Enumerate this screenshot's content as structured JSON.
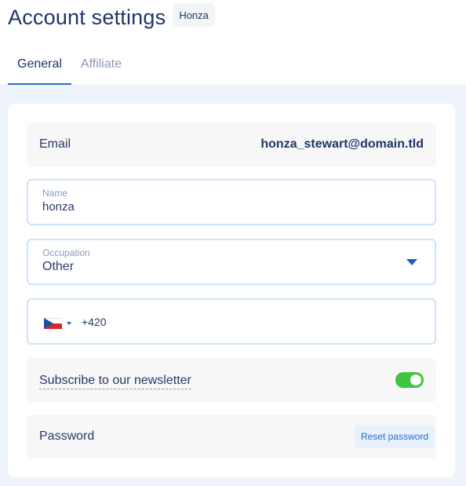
{
  "header": {
    "title": "Account settings",
    "user_badge": "Honza"
  },
  "tabs": [
    {
      "label": "General",
      "active": true
    },
    {
      "label": "Affiliate",
      "active": false
    }
  ],
  "email": {
    "label": "Email",
    "value": "honza_stewart@domain.tld"
  },
  "name_field": {
    "label": "Name",
    "value": "honza"
  },
  "occupation_field": {
    "label": "Occupation",
    "value": "Other"
  },
  "phone_field": {
    "country_flag": "czech-flag-icon",
    "value": "+420"
  },
  "newsletter": {
    "label": "Subscribe to our newsletter",
    "enabled": true
  },
  "password": {
    "label": "Password",
    "reset_label": "Reset password"
  },
  "colors": {
    "accent": "#2f6dcc",
    "title": "#1f3568",
    "toggle_on": "#3ec43e",
    "field_border": "#cce3f8",
    "content_bg": "#eef3fc"
  }
}
